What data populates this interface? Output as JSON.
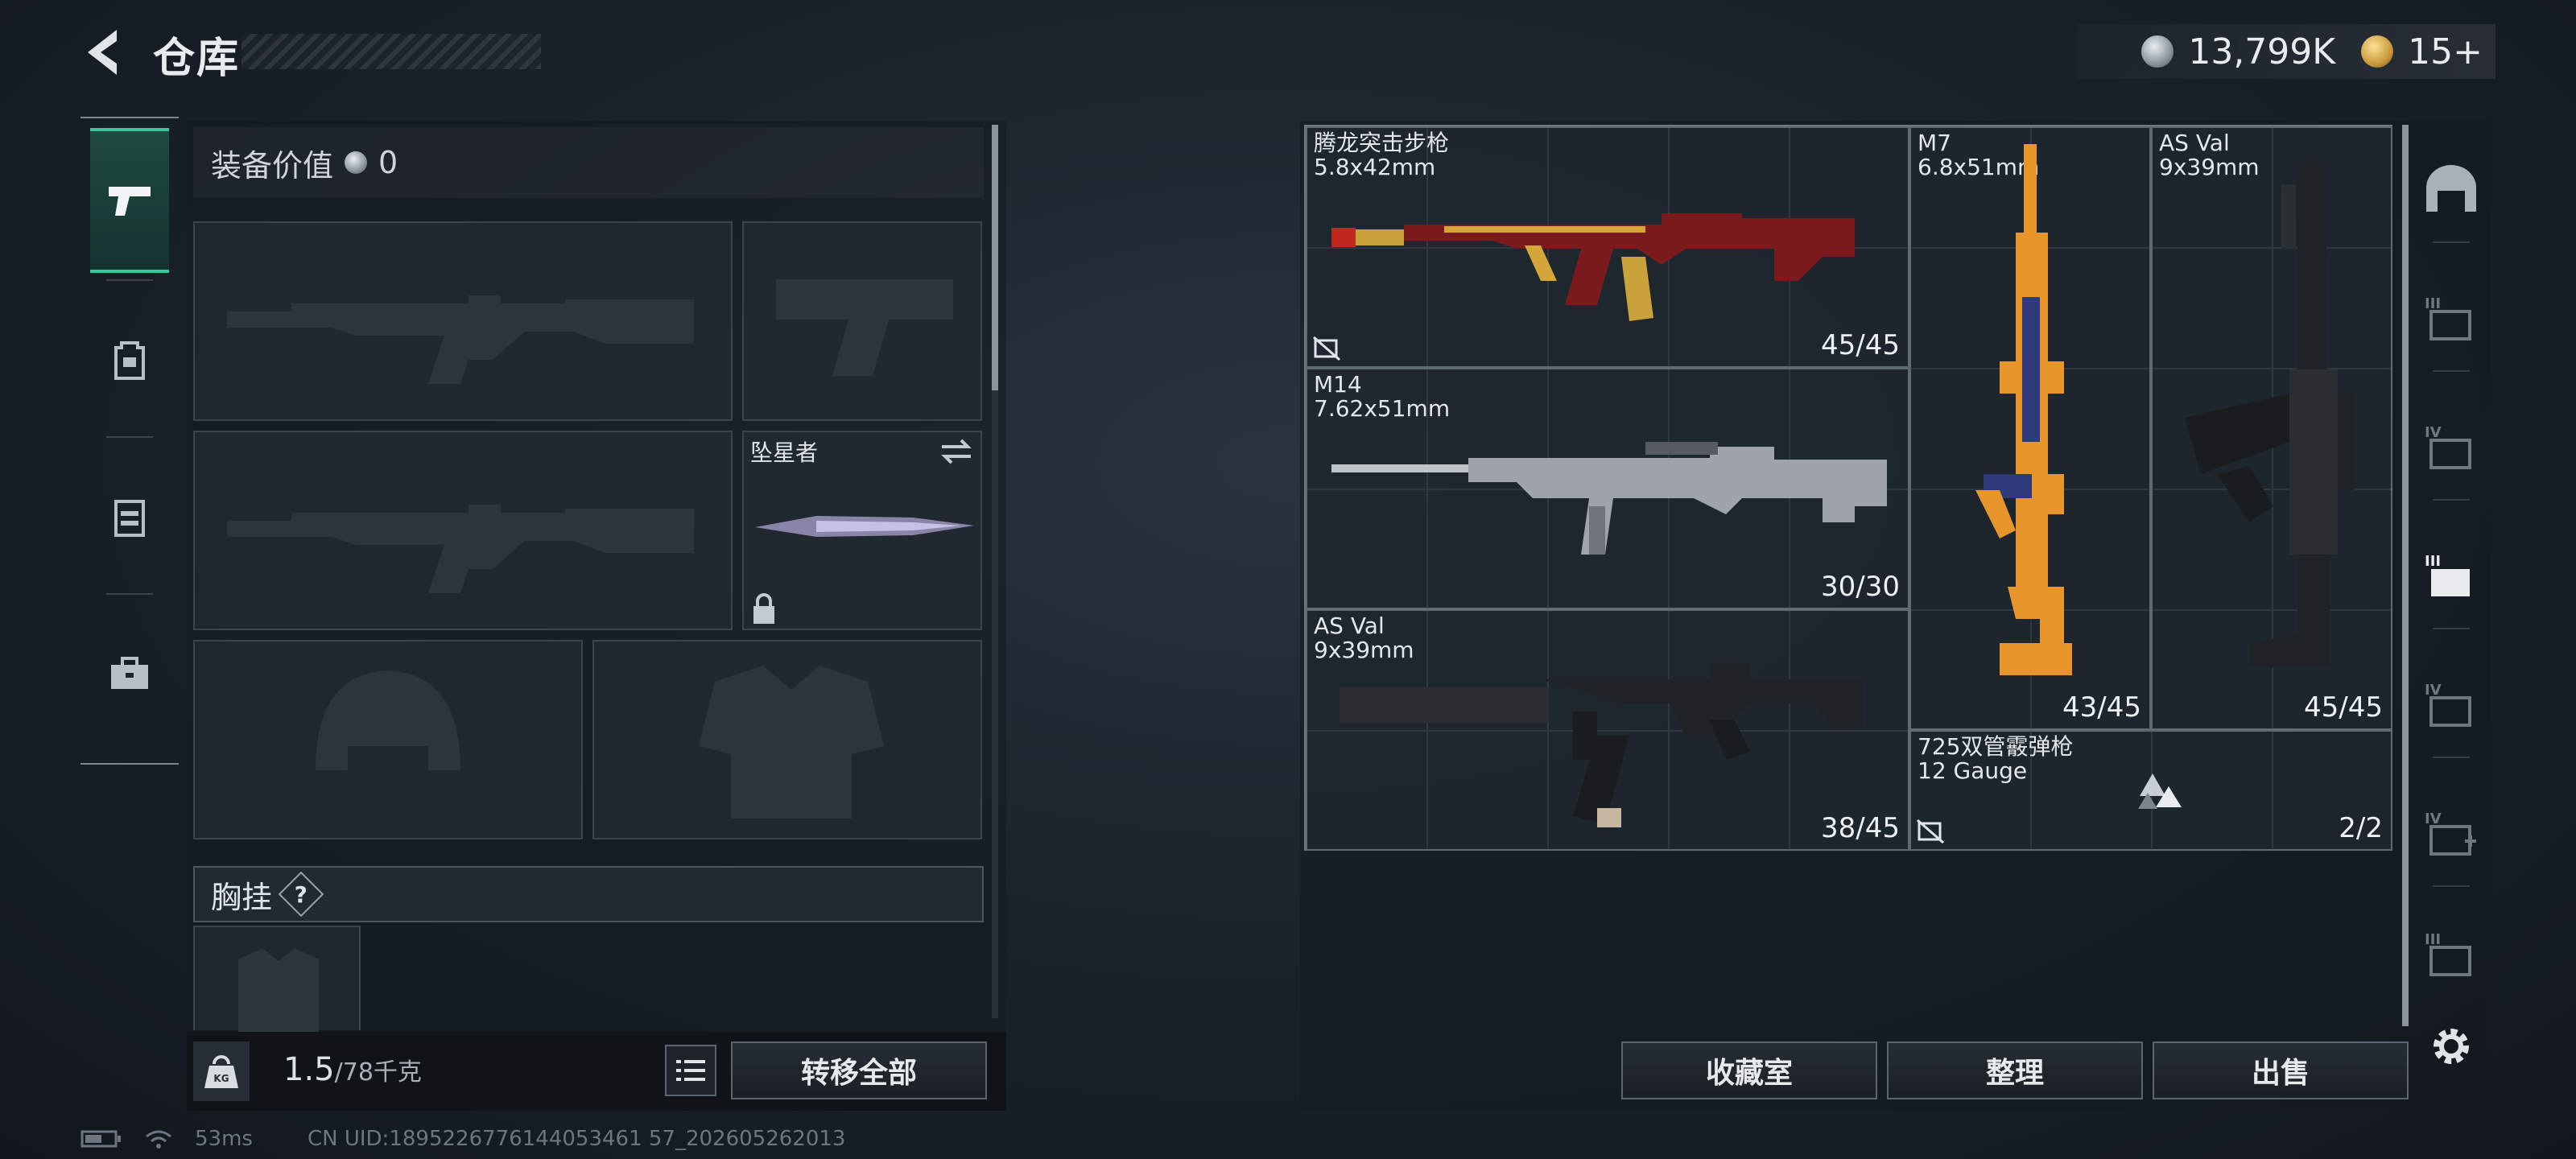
{
  "header": {
    "title": "仓库",
    "currency": [
      {
        "icon": "silver-coin-icon",
        "value": "13,799K"
      },
      {
        "icon": "gold-coin-icon",
        "value": "15+"
      }
    ]
  },
  "left_tabs": [
    {
      "name": "weapons-tab",
      "icon": "pistol-icon",
      "active": true
    },
    {
      "name": "backpack-tab",
      "icon": "backpack-icon",
      "active": false
    },
    {
      "name": "chest-rig-tab",
      "icon": "vest-icon",
      "active": false
    },
    {
      "name": "container-tab",
      "icon": "case-icon",
      "active": false
    }
  ],
  "loadout": {
    "equip_value_label": "装备价值",
    "equip_value": "0",
    "melee_name": "坠星者",
    "chest_rig_label": "胸挂",
    "chest_rig_help": "?",
    "weight_current": "1.5",
    "weight_max": "/78千克",
    "transfer_all": "转移全部"
  },
  "stash_items": [
    {
      "name": "腾龙突击步枪",
      "caliber": "5.8x42mm",
      "ammo": "45/45"
    },
    {
      "name": "M7",
      "caliber": "6.8x51mm",
      "ammo": "43/45"
    },
    {
      "name": "AS Val",
      "caliber": "9x39mm",
      "ammo": "45/45"
    },
    {
      "name": "M14",
      "caliber": "7.62x51mm",
      "ammo": "30/30"
    },
    {
      "name": "AS Val",
      "caliber": "9x39mm",
      "ammo": "38/45"
    },
    {
      "name": "725双管霰弹枪",
      "caliber": "12 Gauge",
      "ammo": "2/2"
    }
  ],
  "actions": {
    "collection": "收藏室",
    "organize": "整理",
    "sell": "出售"
  },
  "status": {
    "ping": "53ms",
    "uid": "CN UID:1895226776144053461 57_202605262013"
  },
  "colors": {
    "accent": "#37c79a",
    "panel": "#1b232c"
  }
}
